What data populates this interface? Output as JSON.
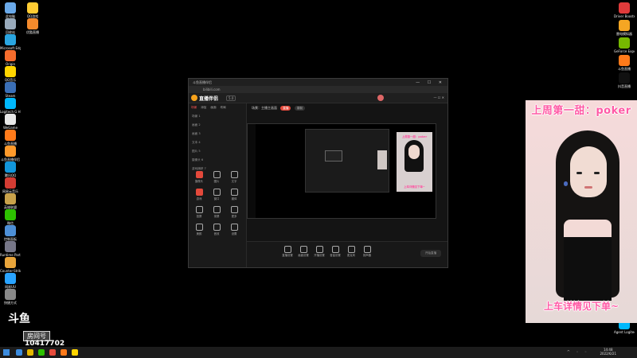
{
  "desktop": {
    "left_icons": [
      {
        "label": "此电脑",
        "color": "#6aa9e9"
      },
      {
        "label": "QQ游戏",
        "color": "#ffcc33"
      },
      {
        "label": "回收站",
        "color": "#9ab"
      },
      {
        "label": "优酷直播",
        "color": "#f48a2c"
      },
      {
        "label": "Microsoft Edge",
        "color": "#2aa5e0"
      },
      {
        "label": "Origin",
        "color": "#f56c2d"
      },
      {
        "label": "QQ音乐",
        "color": "#ffd500"
      },
      {
        "label": "Steam",
        "color": "#3b6fb6"
      },
      {
        "label": "Logitech G HUB",
        "color": "#00b8fc"
      },
      {
        "label": "WeGame",
        "color": "#e8e8e8"
      },
      {
        "label": "斗鱼直播",
        "color": "#ff7a1a"
      },
      {
        "label": "斗鱼直播伴侣",
        "color": "#ff9a2b"
      },
      {
        "label": "腾讯QQ",
        "color": "#1296db"
      },
      {
        "label": "网易云音乐",
        "color": "#d43c33"
      },
      {
        "label": "英雄联盟",
        "color": "#c8a24b"
      },
      {
        "label": "微信",
        "color": "#2dc100"
      },
      {
        "label": "控制面板",
        "color": "#4d8fd6"
      },
      {
        "label": "Runtime Party",
        "color": "#778"
      },
      {
        "label": "Counter-Strike",
        "color": "#e9a53b"
      },
      {
        "label": "网易UU",
        "color": "#29a3ff"
      },
      {
        "label": "快捷方式",
        "color": "#888"
      }
    ],
    "right_icons": [
      {
        "label": "Driver Booster",
        "color": "#e03b3b"
      },
      {
        "label": "雷电模拟器",
        "color": "#f5a623"
      },
      {
        "label": "GeForce Experience",
        "color": "#76b900"
      },
      {
        "label": "斗鱼直播",
        "color": "#ff7a1a"
      },
      {
        "label": "抖音直播",
        "color": "#111"
      },
      {
        "label": "Agent Logitech",
        "color": "#00b8fc"
      }
    ]
  },
  "obs_window": {
    "title": "斗鱼直播伴侣",
    "tab": "bilibili.com",
    "inner_tab": "直播伴侣",
    "app_name": "直播伴侣",
    "version": "5.0",
    "controls": "— ☐ ✕",
    "sidebar_tabs": [
      "场景",
      "添加",
      "画面",
      "布局"
    ],
    "scenes": [
      "场景 1",
      "画面 2",
      "画面 3",
      "文本 4",
      "图片 5",
      "摄像头 6",
      "游戏捕获 7"
    ],
    "tools": [
      {
        "label": "摄像头",
        "hot": true
      },
      {
        "label": "图片",
        "hot": false
      },
      {
        "label": "文字",
        "hot": false
      },
      {
        "label": "游戏",
        "hot": true
      },
      {
        "label": "窗口",
        "hot": false
      },
      {
        "label": "媒体",
        "hot": false
      },
      {
        "label": "投屏",
        "hot": false
      },
      {
        "label": "录屏",
        "hot": false
      },
      {
        "label": "更多",
        "hot": false
      },
      {
        "label": "美颜",
        "hot": false
      },
      {
        "label": "音效",
        "hot": false
      },
      {
        "label": "设置",
        "hot": false
      }
    ],
    "scene_bar_label": "场景：主播主画面",
    "scene_pill": "直播",
    "scene_pill2": "录制",
    "preview_cap_top": "上周第一甜：poker",
    "preview_cap_bottom": "上车详情见下单~",
    "bottom_tools": [
      "直播设置",
      "画面设置",
      "开播设置",
      "音量设置",
      "麦克风",
      "扬声器"
    ],
    "start_label": "开始直播"
  },
  "cam_panel": {
    "top_text": "上周第一甜：poker",
    "bottom_text": "上车详情见下单~"
  },
  "watermark": {
    "logo": "斗鱼",
    "room_label": "房间号",
    "room_id": "10417702"
  },
  "taskbar": {
    "time": "14:48",
    "date": "2022/6/21",
    "icons": [
      "#3c8cde",
      "#e6b800",
      "#2dc100",
      "#e74c3c",
      "#ff7a1a",
      "#ffd500"
    ]
  }
}
